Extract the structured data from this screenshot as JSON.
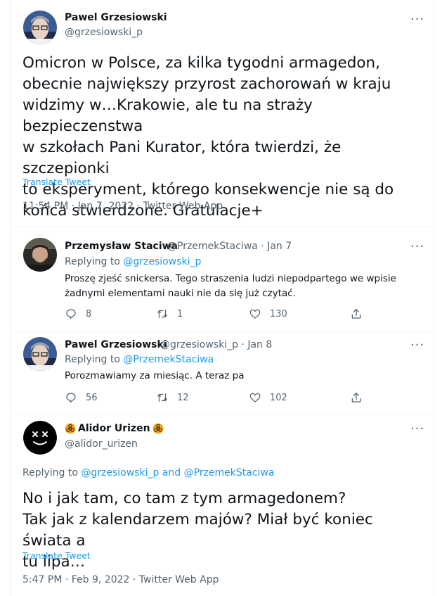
{
  "main_tweet": {
    "name": "Pawel Grzesiowski",
    "handle": "@grzesiowski_p",
    "text_lines": [
      "Omicron w Polsce, za kilka tygodni armagedon,",
      "obecnie największy przyrost zachorowań w kraju",
      "widzimy w…Krakowie, ale tu na straży bezpieczenstwa",
      "w szkołach Pani Kurator, która twierdzi, że szczepionki",
      "to eksperyment, którego konsekwencje nie są do",
      "końca stwierdzone. Gratulacje+"
    ],
    "translate": "Translate Tweet",
    "meta": "11:54 PM · Jan 7, 2022 · Twitter Web App"
  },
  "reply1": {
    "name": "Przemysław Staciwa",
    "handle_date": "@PrzemekStaciwa · Jan 7",
    "replying_prefix": "Replying to ",
    "replying_to": "@grzesiowski_p",
    "text_lines": [
      "Proszę zjeść snickersa. Tego straszenia ludzi niepodpartego we wpisie",
      "żadnymi elementami nauki nie da się już czytać."
    ],
    "stats": {
      "replies": "8",
      "retweets": "1",
      "likes": "130"
    }
  },
  "reply2": {
    "name": "Pawel Grzesiowski",
    "handle_date": "@grzesiowski_p · Jan 8",
    "replying_prefix": "Replying to ",
    "replying_to": "@PrzemekStaciwa",
    "text": "Porozmawiamy za miesiąc. A teraz pa",
    "stats": {
      "replies": "56",
      "retweets": "12",
      "likes": "102"
    }
  },
  "focus_tweet": {
    "name": "Alidor Urizen",
    "handle": "@alidor_urizen",
    "replying_prefix": "Replying to ",
    "replying_to_1": "@grzesiowski_p",
    "replying_and": " and ",
    "replying_to_2": "@PrzemekStaciwa",
    "text_lines": [
      "No i jak tam, co tam z tym armagedonem?",
      "Tak jak z kalendarzem majów? Miał być koniec świata a",
      "tu lipa…"
    ],
    "translate": "Translate Tweet",
    "meta": "5:47 PM · Feb 9, 2022 · Twitter Web App"
  },
  "more_label": "···",
  "colors": {
    "accent": "#1d9bf0",
    "muted": "#536471",
    "text": "#0f1419",
    "divider": "#eff3f4"
  }
}
